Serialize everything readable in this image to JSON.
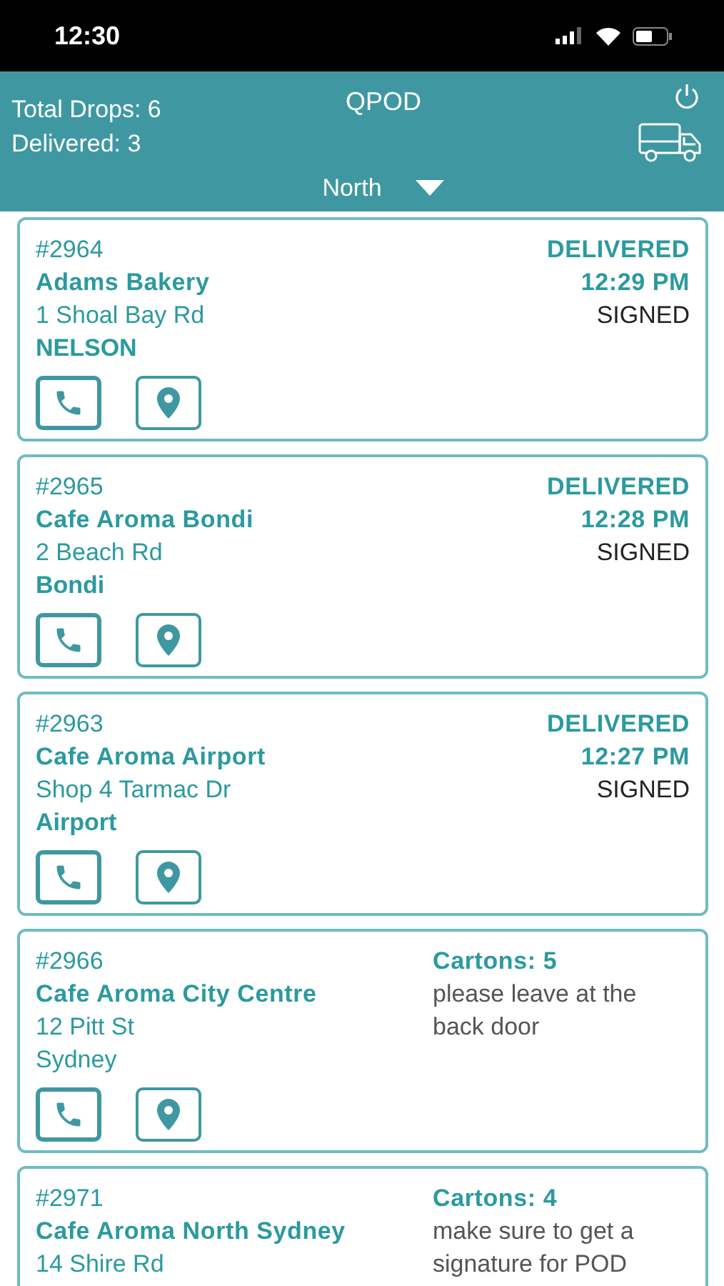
{
  "status_bar": {
    "time": "12:30"
  },
  "header": {
    "logo": "QPOD",
    "total_drops": "Total Drops: 6",
    "delivered": "Delivered: 3",
    "region": "North"
  },
  "drops": [
    {
      "kind": "delivered",
      "number": "#2964",
      "name": "Adams Bakery",
      "address": "1 Shoal Bay Rd",
      "suburb": "NELSON",
      "status": "DELIVERED",
      "time": "12:29 PM",
      "proof": "SIGNED"
    },
    {
      "kind": "delivered",
      "number": "#2965",
      "name": "Cafe Aroma Bondi",
      "address": "2 Beach Rd",
      "suburb": "Bondi",
      "status": "DELIVERED",
      "time": "12:28 PM",
      "proof": "SIGNED"
    },
    {
      "kind": "delivered",
      "number": "#2963",
      "name": "Cafe Aroma Airport",
      "address": "Shop 4 Tarmac Dr",
      "suburb": "Airport",
      "status": "DELIVERED",
      "time": "12:27 PM",
      "proof": "SIGNED"
    },
    {
      "kind": "pending",
      "number": "#2966",
      "name": "Cafe Aroma City Centre",
      "address": "12 Pitt St",
      "suburb": "Sydney",
      "cartons": "Cartons: 5",
      "note": "please leave at the back door"
    },
    {
      "kind": "pending",
      "number": "#2971",
      "name": "Cafe Aroma North Sydney",
      "address": "14 Shire Rd",
      "cartons": "Cartons: 4",
      "note": "make sure to get a signature for POD"
    }
  ]
}
